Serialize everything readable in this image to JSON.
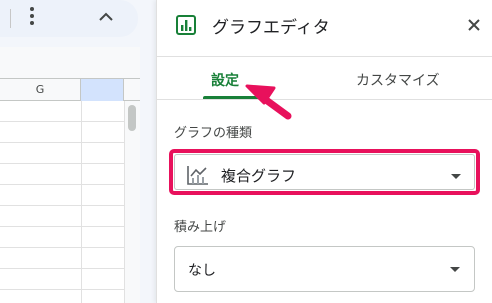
{
  "sheet": {
    "column_label": "G"
  },
  "panel": {
    "title": "グラフエディタ",
    "tabs": [
      {
        "label": "設定",
        "active": true
      },
      {
        "label": "カスタマイズ",
        "active": false
      }
    ],
    "chart_type": {
      "label": "グラフの種類",
      "value": "複合グラフ",
      "icon": "combo-chart-icon"
    },
    "stacking": {
      "label": "積み上げ",
      "value": "なし"
    }
  },
  "colors": {
    "accent": "#188038",
    "highlight_box": "#e8115c",
    "annotation_arrow": "#e8115c",
    "selected_column": "#d3e3fd"
  }
}
